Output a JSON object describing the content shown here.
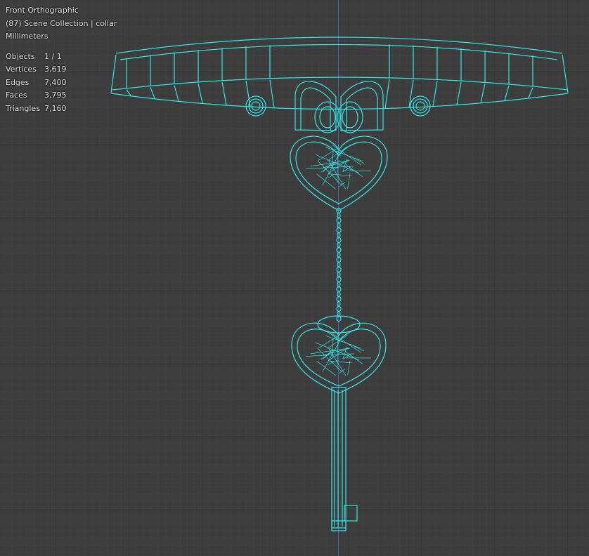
{
  "viewport": {
    "view_name": "Front Orthographic",
    "collection": "(87) Scene Collection | collar",
    "units": "Millimeters"
  },
  "stats": [
    {
      "label": "Objects",
      "value": "1 / 1"
    },
    {
      "label": "Vertices",
      "value": "3,619"
    },
    {
      "label": "Edges",
      "value": "7,400"
    },
    {
      "label": "Faces",
      "value": "3,795"
    },
    {
      "label": "Triangles",
      "value": "7,160"
    }
  ],
  "colors": {
    "background": "#3d3d3d",
    "grid_minor": "#454545",
    "grid_major": "#2f2f2f",
    "wire": "#33e6e6",
    "axis_z": "#3d5fa8"
  },
  "object": {
    "name": "collar",
    "parts": [
      "collar-band-icon",
      "bow-icon",
      "heart-lock-icon",
      "chain-icon",
      "heart-key-icon"
    ]
  }
}
